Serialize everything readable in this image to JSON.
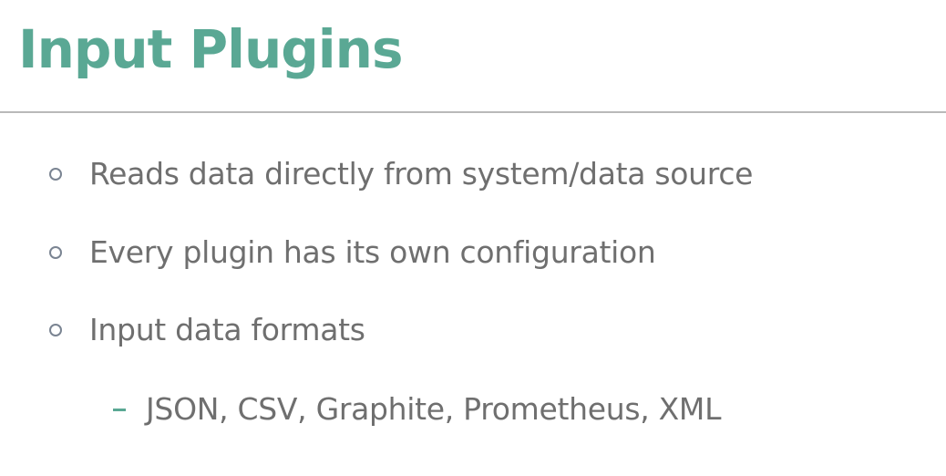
{
  "slide": {
    "title": "Input Plugins",
    "accent_color": "#5aa894",
    "text_color": "#6f6f6f",
    "bullets": [
      "Reads data directly from system/data source",
      "Every plugin has its own configuration",
      "Input data formats"
    ],
    "sub_bullets": [
      "JSON, CSV, Graphite, Prometheus, XML"
    ]
  }
}
